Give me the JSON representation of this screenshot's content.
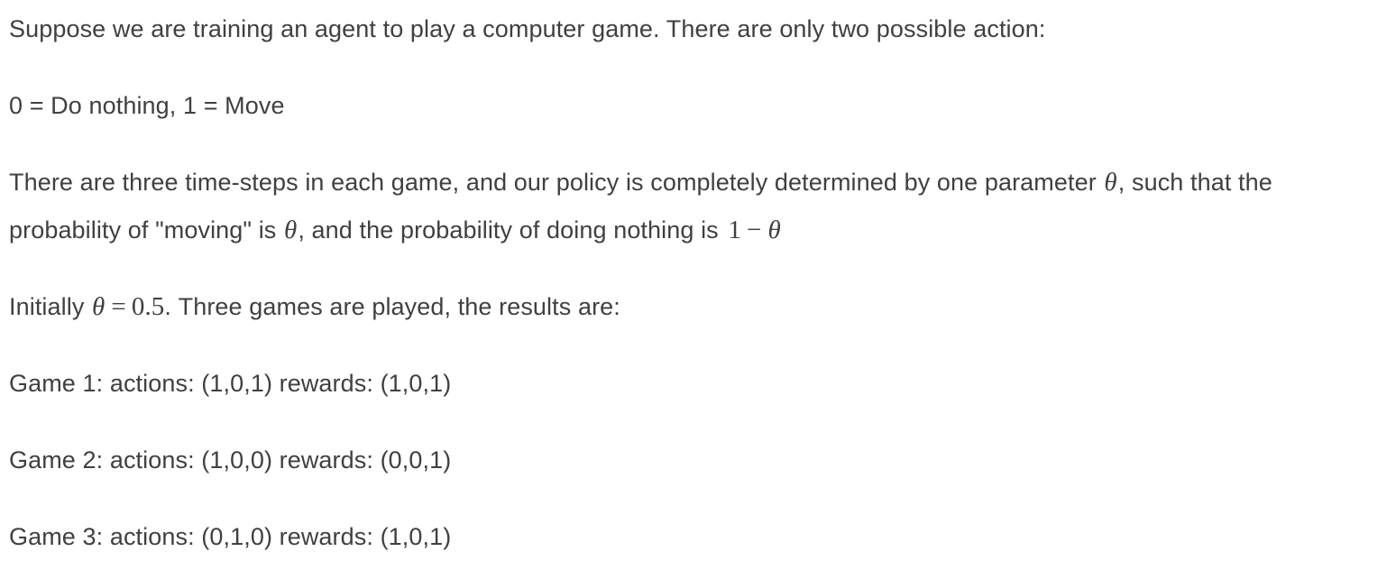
{
  "document": {
    "background_color": "#ffffff",
    "text_color": "#404040",
    "paragraphs": [
      {
        "id": "intro",
        "text": "Suppose we are training an agent to play a computer game. There are only two possible action:"
      },
      {
        "id": "actions",
        "text": "0 = Do nothing, 1 = Move"
      },
      {
        "id": "policy",
        "text_before_theta": "There are three time-steps in each game, and our policy is completely determined by one parameter ",
        "theta_symbol": "θ",
        "text_after_theta": ", such that the probability of \"moving\" is ",
        "theta_symbol_2": "θ",
        "text_after_theta_2": ", and the probability of doing nothing is ",
        "expression_one_minus_theta": {
          "one": "1",
          "minus": "−",
          "theta": "θ"
        }
      },
      {
        "id": "initial-value",
        "text_before": "Initially ",
        "expression_theta_equals": {
          "theta": "θ",
          "equals": "=",
          "value": "0.5"
        },
        "text_after": ". Three games are played, the results are:"
      }
    ],
    "games": [
      {
        "label": "Game 1:",
        "actions_label": "actions:",
        "actions": "(1,0,1)",
        "rewards_label": "rewards:",
        "rewards": "(1,0,1)",
        "line": "Game 1: actions: (1,0,1) rewards: (1,0,1)"
      },
      {
        "label": "Game 2:",
        "actions_label": "actions:",
        "actions": "(1,0,0)",
        "rewards_label": "rewards:",
        "rewards": "(0,0,1)",
        "line": "Game 2: actions: (1,0,0) rewards: (0,0,1)"
      },
      {
        "label": "Game 3:",
        "actions_label": "actions:",
        "actions": "(0,1,0)",
        "rewards_label": "rewards:",
        "rewards": "(1,0,1)",
        "line": "Game 3: actions: (0,1,0) rewards: (1,0,1)"
      }
    ]
  }
}
